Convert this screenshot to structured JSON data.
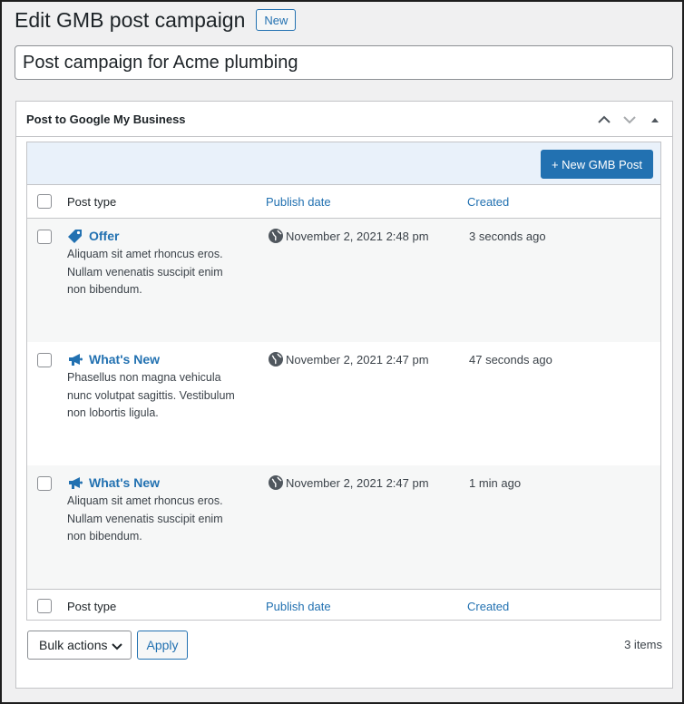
{
  "header": {
    "title": "Edit GMB post campaign",
    "new_label": "New"
  },
  "title_input": {
    "value": "Post campaign for Acme plumbing"
  },
  "postbox": {
    "title": "Post to Google My Business",
    "controls": [
      "chevron-up-icon",
      "chevron-down-icon",
      "caret-up-icon"
    ]
  },
  "toolbar": {
    "new_post_label": "+ New GMB Post"
  },
  "columns": {
    "type": "Post type",
    "date": "Publish date",
    "created": "Created"
  },
  "rows": [
    {
      "type": "Offer",
      "icon": "tag-icon",
      "excerpt": [
        "Aliquam sit amet rhoncus eros.",
        "Nullam venenatis suscipit enim",
        "non bibendum."
      ],
      "date": "November 2, 2021 2:48 pm",
      "created": "3 seconds ago"
    },
    {
      "type": "What's New",
      "icon": "megaphone-icon",
      "excerpt": [
        "Phasellus non magna vehicula",
        "nunc volutpat sagittis. Vestibulum",
        "non lobortis ligula."
      ],
      "date": "November 2, 2021 2:47 pm",
      "created": "47 seconds ago"
    },
    {
      "type": "What's New",
      "icon": "megaphone-icon",
      "excerpt": [
        "Aliquam sit amet rhoncus eros.",
        "Nullam venenatis suscipit enim",
        "non bibendum."
      ],
      "date": "November 2, 2021 2:47 pm",
      "created": "1 min ago"
    }
  ],
  "bottom": {
    "bulk_actions": "Bulk actions",
    "apply": "Apply",
    "count": "3 items"
  },
  "colors": {
    "accent": "#2271b1",
    "toolbar_bg": "#e9f1fa",
    "alt_row": "#f6f7f7"
  }
}
